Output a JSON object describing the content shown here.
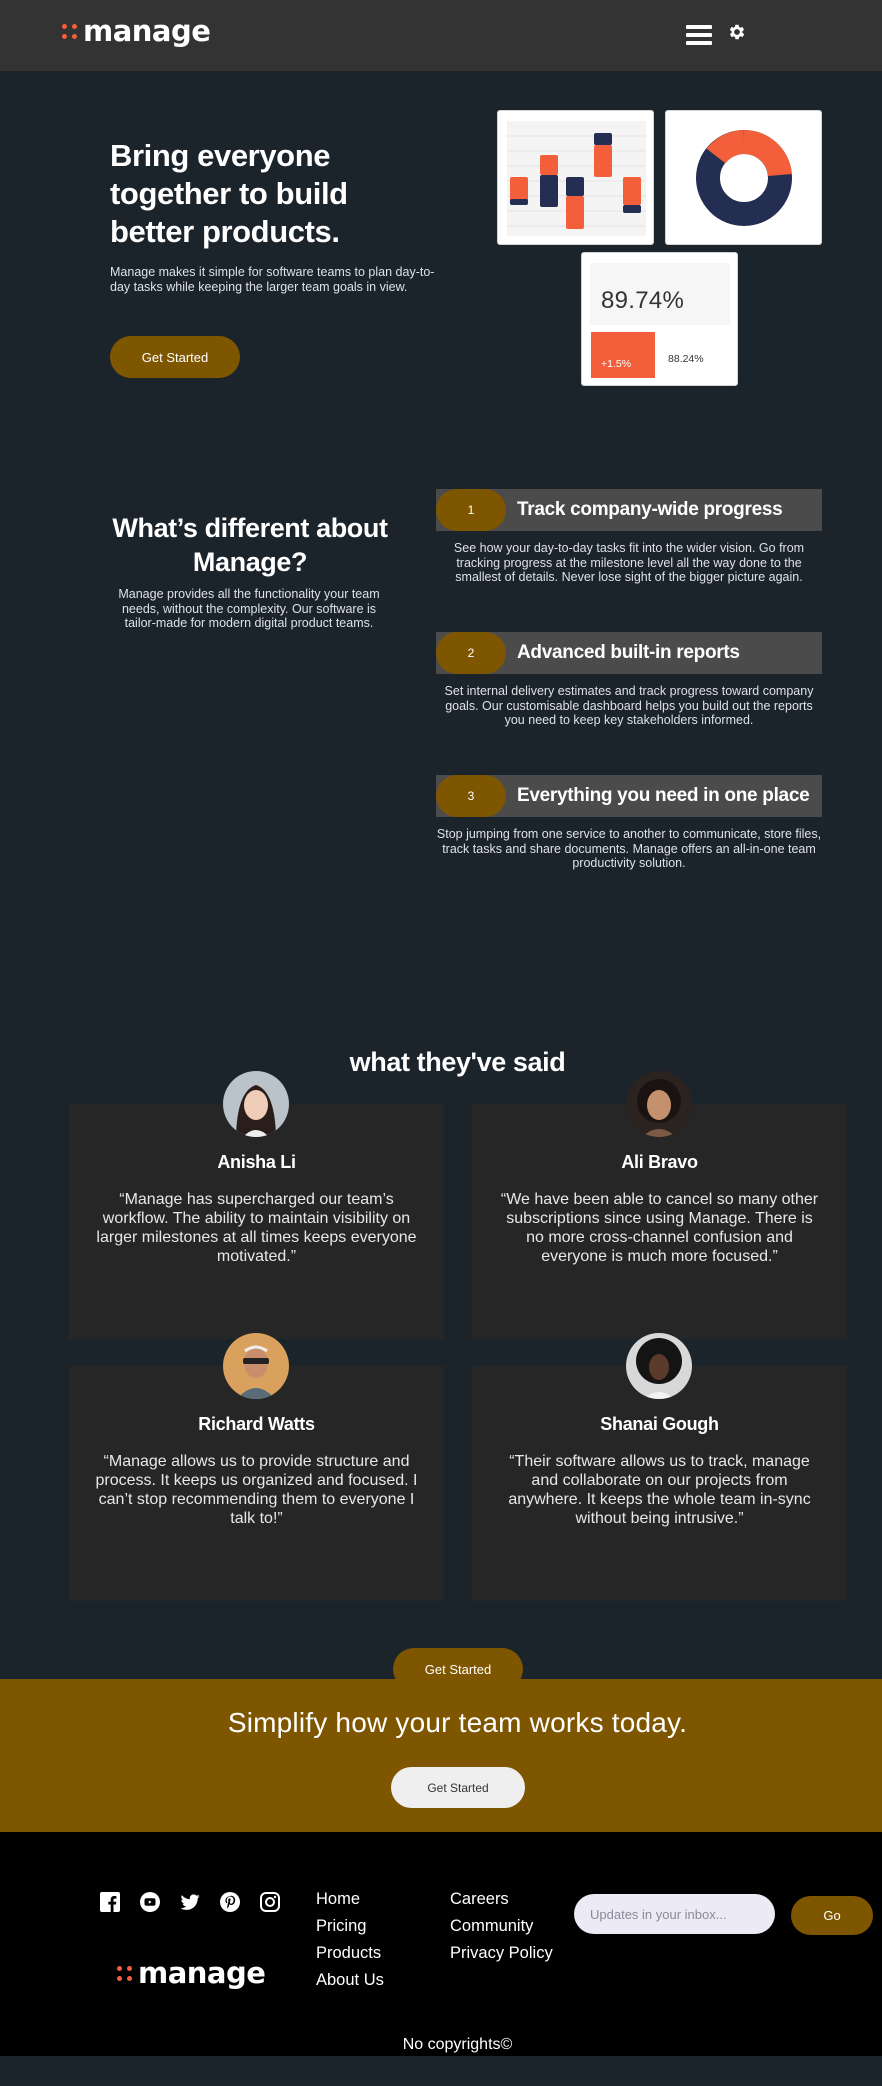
{
  "header": {
    "logo_text": "manage"
  },
  "hero": {
    "title": "Bring everyone together to build better products.",
    "description": "Manage makes it simple for software teams to plan day-to-day tasks while keeping the larger team goals in view.",
    "cta": "Get Started",
    "stat_main": "89.74%",
    "stat_change": "+1.5%",
    "stat_secondary": "88.24%",
    "colors": {
      "accent": "#f25f3a",
      "navy": "#242d52"
    }
  },
  "different": {
    "title": "What’s different about Manage?",
    "description": "Manage provides all the functionality your team needs, without the complexity. Our software is tailor-made for modern digital product teams.",
    "features": [
      {
        "num": "1",
        "title": "Track company-wide progress",
        "desc": "See how your day-to-day tasks fit into the wider vision. Go from tracking progress at the milestone level all the way done to the smallest of details. Never lose sight of the bigger picture again."
      },
      {
        "num": "2",
        "title": "Advanced built-in reports",
        "desc": "Set internal delivery estimates and track progress toward company goals. Our customisable dashboard helps you build out the reports you need to keep key stakeholders informed."
      },
      {
        "num": "3",
        "title": "Everything you need in one place",
        "desc": "Stop jumping from one service to another to communicate, store files, track tasks and share documents. Manage offers an all-in-one team productivity solution."
      }
    ]
  },
  "testimonials": {
    "title": "what they've said",
    "items": [
      {
        "name": "Anisha Li",
        "quote": "“Manage has supercharged our team’s workflow. The ability to maintain visibility on larger milestones at all times keeps everyone motivated.”"
      },
      {
        "name": "Ali Bravo",
        "quote": "“We have been able to cancel so many other subscriptions since using Manage. There is no more cross-channel confusion and everyone is much more focused.”"
      },
      {
        "name": "Richard Watts",
        "quote": "“Manage allows us to provide structure and process. It keeps us organized and focused. I can’t stop recommending them to everyone I talk to!”"
      },
      {
        "name": "Shanai Gough",
        "quote": "“Their software allows us to track, manage and collaborate on our projects from anywhere. It keeps the whole team in-sync without being intrusive.”"
      }
    ],
    "cta": "Get Started"
  },
  "cta_band": {
    "title": "Simplify how your team works today.",
    "button": "Get Started"
  },
  "footer": {
    "logo_text": "manage",
    "socials": [
      "facebook-icon",
      "youtube-icon",
      "twitter-icon",
      "pinterest-icon",
      "instagram-icon"
    ],
    "links_col1": [
      "Home",
      "Pricing",
      "Products",
      "About Us"
    ],
    "links_col2": [
      "Careers",
      "Community",
      "Privacy Policy"
    ],
    "newsletter_placeholder": "Updates in your inbox...",
    "go_label": "Go",
    "copyright": "No copyrights©"
  }
}
